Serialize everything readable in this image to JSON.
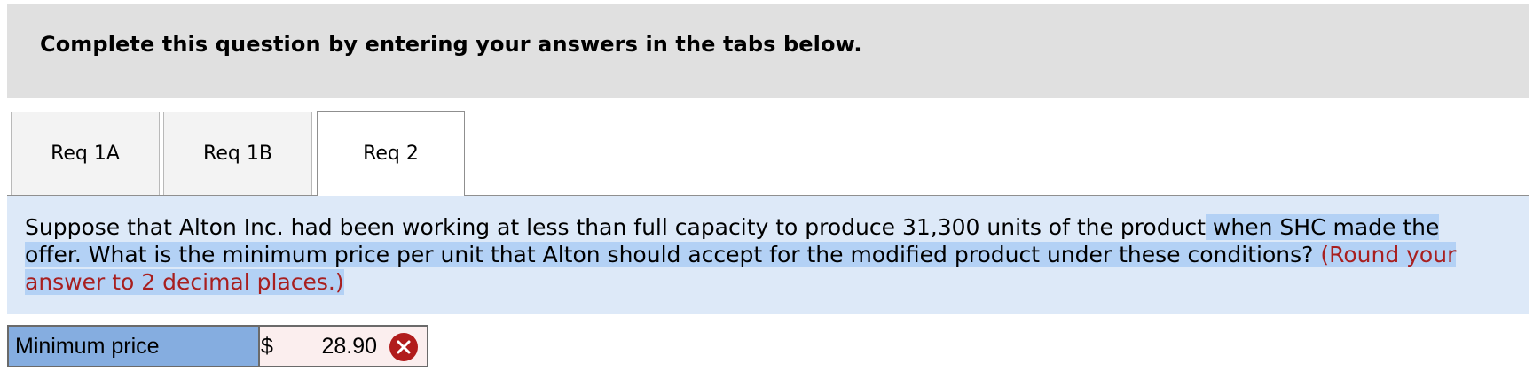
{
  "header": {
    "title": "Complete this question by entering your answers in the tabs below."
  },
  "tabs": [
    {
      "label": "Req 1A",
      "active": false
    },
    {
      "label": "Req 1B",
      "active": false
    },
    {
      "label": "Req 2",
      "active": true
    }
  ],
  "question": {
    "text_part1": "Suppose that Alton Inc. had been working at less than full capacity to produce 31,300 units of the product",
    "text_part2_highlighted": " when SHC made the offer. What is the minimum price per unit that Alton should accept for the modified product under these conditions? ",
    "instruction": "(Round your answer to 2 decimal places.)"
  },
  "answer": {
    "label": "Minimum price",
    "currency": "$",
    "value": "28.90",
    "status": "incorrect"
  },
  "colors": {
    "header_bg": "#e0e0e0",
    "question_bg": "#dde9f8",
    "selection_highlight": "#b3d1f5",
    "instruction_red": "#a81f1f",
    "label_bg": "#85ade0",
    "input_bg": "#fbeeee",
    "error_red": "#b11c1c"
  },
  "icons": {
    "status_icon": "close-circle-icon"
  }
}
